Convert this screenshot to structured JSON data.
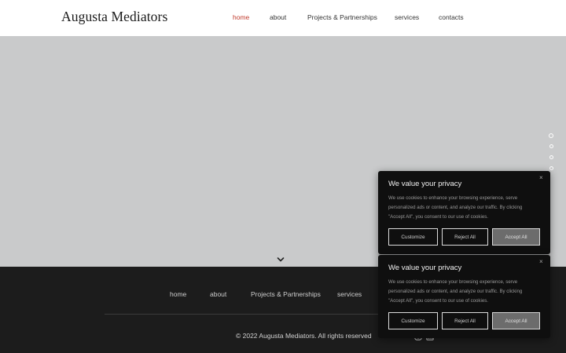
{
  "header": {
    "logo": "Augusta Mediators",
    "nav": [
      {
        "label": "home",
        "active": true
      },
      {
        "label": "about",
        "active": false
      },
      {
        "label": "Projects & Partnerships",
        "active": false
      },
      {
        "label": "services",
        "active": false
      },
      {
        "label": "contacts",
        "active": false
      }
    ]
  },
  "hero": {
    "background_color": "#c9cacb",
    "scroll_icon": "chevron-down-icon",
    "slide_dots": 4
  },
  "footer": {
    "nav": [
      "home",
      "about",
      "Projects & Partnerships",
      "services"
    ],
    "copyright": "© 2022 Augusta Mediators. All rights reserved",
    "social_icons": [
      "instagram-icon",
      "linkedin-icon"
    ]
  },
  "cookie_banners": [
    {
      "title": "We value your privacy",
      "body": "We use cookies to enhance your browsing experience, serve personalized ads or content, and analyze our traffic. By clicking \"Accept All\", you consent to our use of cookies.",
      "customize": "Customize",
      "reject": "Reject All",
      "accept": "Accept All",
      "close": "×"
    },
    {
      "title": "We value your privacy",
      "body": "We use cookies to enhance your browsing experience, serve personalized ads or content, and analyze our traffic. By clicking \"Accept All\", you consent to our use of cookies.",
      "customize": "Customize",
      "reject": "Reject All",
      "accept": "Accept All",
      "close": "×"
    }
  ],
  "colors": {
    "accent": "#c0392b",
    "footer_bg": "#1c1c1c",
    "banner_bg": "#0f0f0f"
  }
}
